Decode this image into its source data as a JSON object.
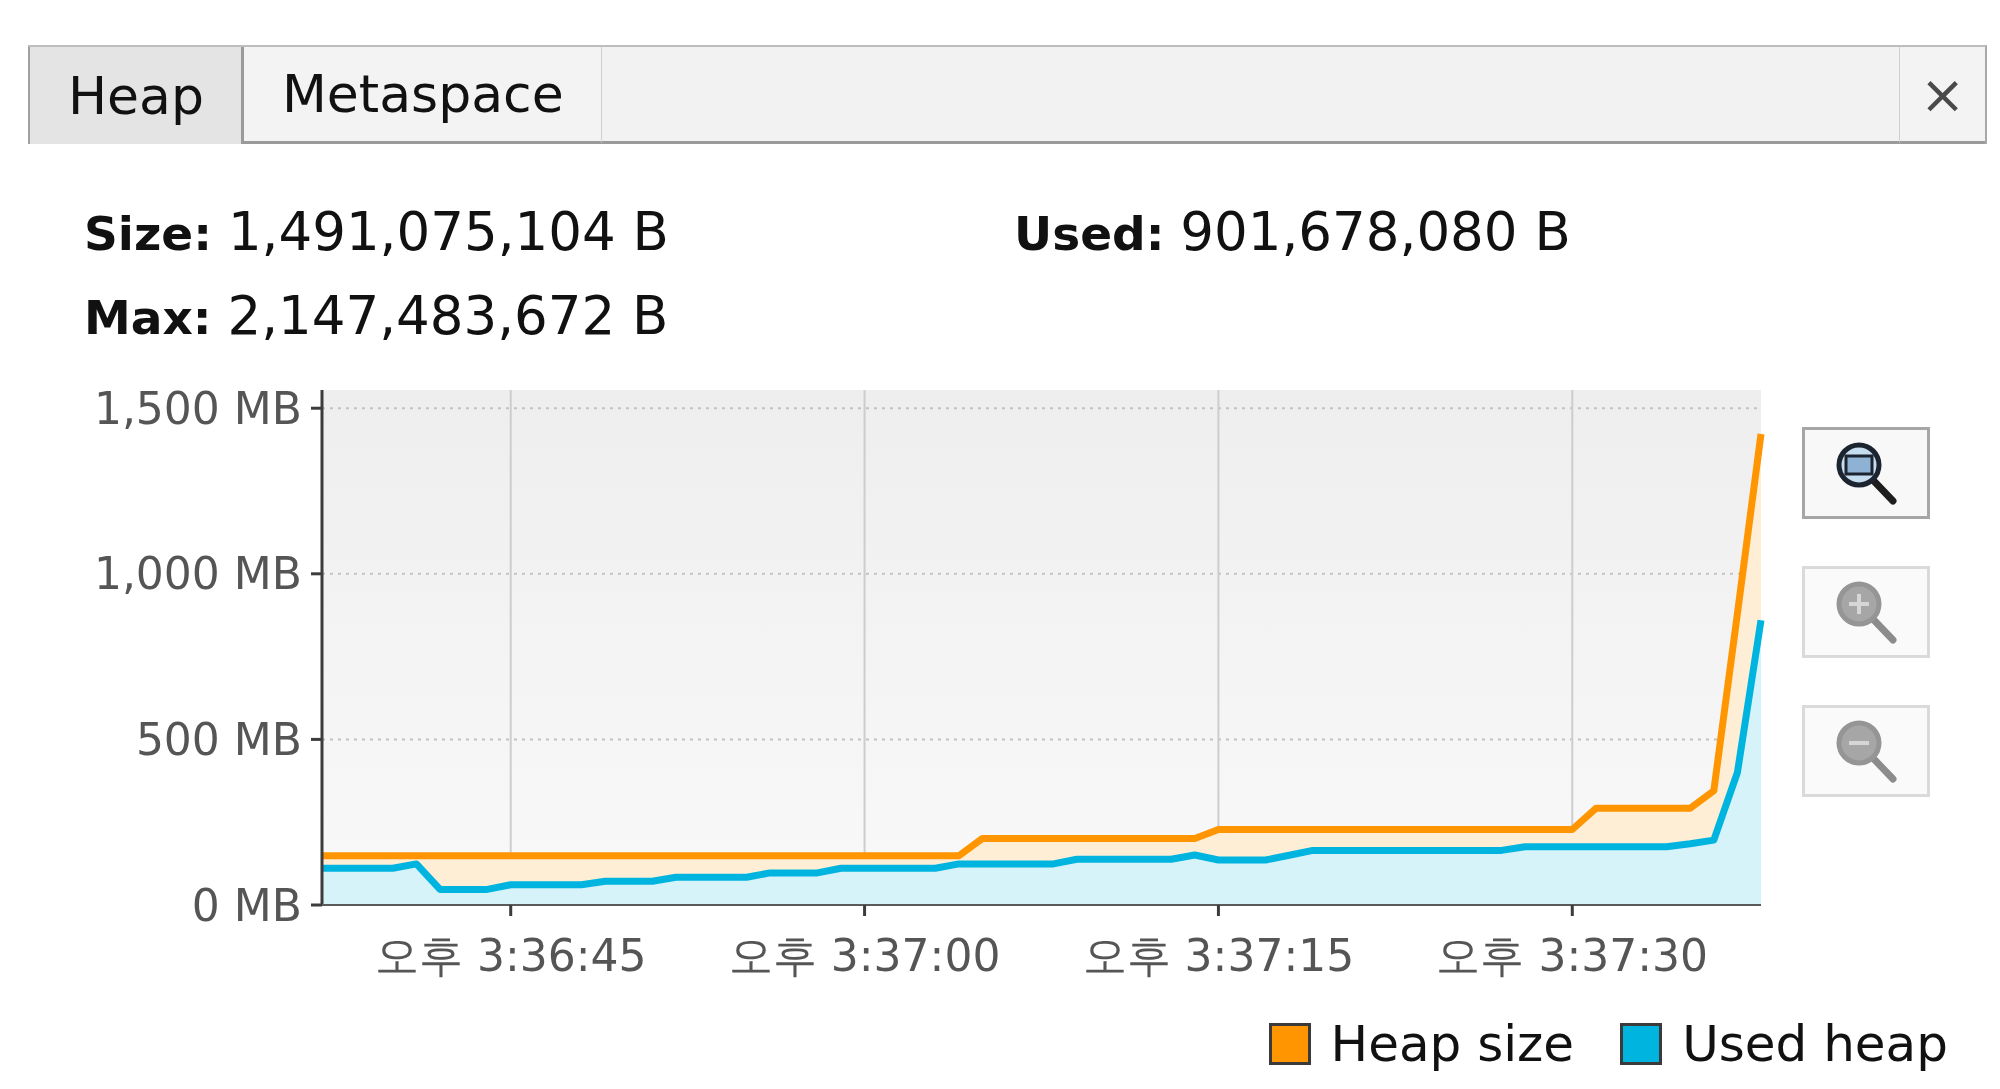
{
  "tabs": [
    {
      "label": "Heap",
      "selected": true
    },
    {
      "label": "Metaspace",
      "selected": false
    }
  ],
  "close_button": {
    "label": "×"
  },
  "stats": [
    {
      "label": "Size:",
      "value": "1,491,075,104 B"
    },
    {
      "label": "Used:",
      "value": "901,678,080 B"
    },
    {
      "label": "Max:",
      "value": "2,147,483,672 B"
    }
  ],
  "chart": {
    "chart_data": [
      {
        "type": "area",
        "categories": [
          null,
          null,
          null,
          null,
          null,
          null,
          null,
          null,
          "오후 3:36:45",
          null,
          null,
          null,
          null,
          null,
          null,
          null,
          null,
          null,
          null,
          null,
          null,
          null,
          null,
          "오후 3:37:00",
          null,
          null,
          null,
          null,
          null,
          null,
          null,
          null,
          null,
          null,
          null,
          null,
          null,
          null,
          "오후 3:37:15",
          null,
          null,
          null,
          null,
          null,
          null,
          null,
          null,
          null,
          null,
          null,
          null,
          null,
          null,
          "오후 3:37:30",
          null,
          null,
          null,
          null,
          null,
          null,
          null,
          null
        ],
        "series": [
          {
            "name": "Heap size",
            "color": "#ff9500",
            "values": [
              149,
              149,
              149,
              149,
              149,
              149,
              149,
              149,
              149,
              149,
              149,
              149,
              149,
              149,
              149,
              149,
              149,
              149,
              149,
              149,
              149,
              149,
              149,
              149,
              149,
              149,
              149,
              149,
              201,
              201,
              201,
              201,
              201,
              201,
              201,
              201,
              201,
              201,
              228,
              228,
              228,
              228,
              228,
              228,
              228,
              228,
              228,
              228,
              228,
              228,
              228,
              228,
              228,
              228,
              292,
              292,
              292,
              292,
              292,
              345,
              880,
              1422
            ]
          },
          {
            "name": "Used heap",
            "color": "#00b4e0",
            "values": [
              111,
              111,
              111,
              111,
              124,
              47,
              47,
              47,
              61,
              61,
              61,
              61,
              72,
              72,
              72,
              84,
              84,
              84,
              84,
              97,
              97,
              97,
              111,
              111,
              111,
              111,
              111,
              124,
              124,
              124,
              124,
              124,
              138,
              138,
              138,
              138,
              138,
              151,
              136,
              136,
              136,
              150,
              165,
              165,
              165,
              165,
              165,
              165,
              165,
              165,
              165,
              176,
              176,
              176,
              176,
              176,
              176,
              176,
              185,
              196,
              400,
              860
            ]
          }
        ],
        "ylim": [
          0,
          1555
        ],
        "yticks": [
          {
            "value": 0,
            "label": "0 MB"
          },
          {
            "value": 500,
            "label": "500 MB"
          },
          {
            "value": 1000,
            "label": "1,000 MB"
          },
          {
            "value": 1500,
            "label": "1,500 MB"
          }
        ],
        "grid": true,
        "legend": "bottom-right"
      }
    ]
  },
  "zoom_buttons": [
    {
      "kind": "fit",
      "disabled": false
    },
    {
      "kind": "in",
      "disabled": true
    },
    {
      "kind": "out",
      "disabled": true
    }
  ]
}
